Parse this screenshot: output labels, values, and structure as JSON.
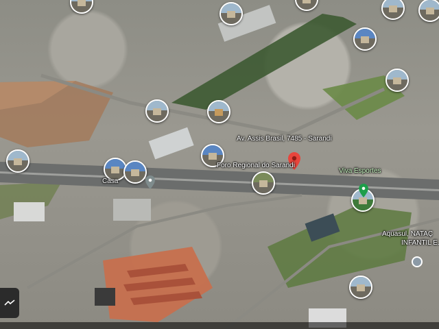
{
  "map": {
    "type": "satellite",
    "accent_colors": {
      "red_pin": "#e8453c",
      "green_pin": "#1e9e4a",
      "gray_pin": "#7f8c8d"
    }
  },
  "labels": {
    "address": "Av. Assis Brasil, 7485 - Sarandi",
    "foro": "Foro Regional do Sarandi",
    "viva": "Viva Esportes",
    "casa": "Casa",
    "aquasul_1": "Aquasul, NATAÇ",
    "aquasul_2": "INFANTIL E..."
  },
  "icons": {
    "red_pin": "map-pin-red-icon",
    "green_pin": "map-pin-green-icon",
    "gray_pin": "map-pin-gray-icon",
    "corner": "chevron-icon"
  }
}
